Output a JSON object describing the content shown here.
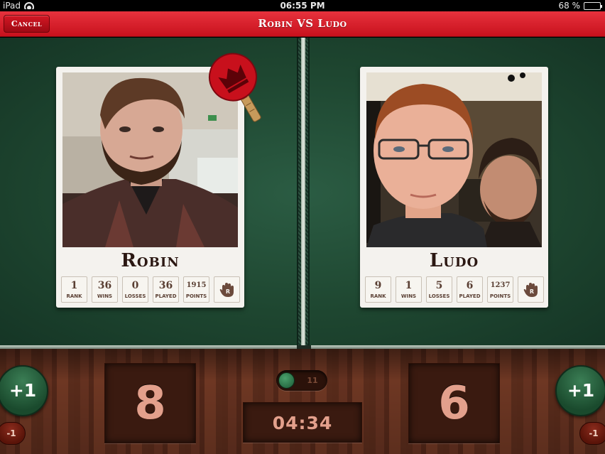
{
  "status_bar": {
    "device": "iPad",
    "time": "06:55 PM",
    "battery": "68 %",
    "battery_level": 0.68
  },
  "nav": {
    "title": "Robin VS Ludo",
    "cancel_label": "Cancel"
  },
  "players": {
    "left": {
      "name": "Robin",
      "stats": [
        {
          "value": "1",
          "label": "RANK"
        },
        {
          "value": "36",
          "label": "WINS"
        },
        {
          "value": "0",
          "label": "LOSSES"
        },
        {
          "value": "36",
          "label": "PLAYED"
        },
        {
          "value": "1915",
          "label": "POINTS"
        }
      ],
      "score": "8"
    },
    "right": {
      "name": "Ludo",
      "stats": [
        {
          "value": "9",
          "label": "RANK"
        },
        {
          "value": "1",
          "label": "WINS"
        },
        {
          "value": "5",
          "label": "LOSSES"
        },
        {
          "value": "6",
          "label": "PLAYED"
        },
        {
          "value": "1237",
          "label": "POINTS"
        }
      ],
      "score": "6"
    }
  },
  "controls": {
    "plus_label": "+1",
    "minus_label": "-1",
    "game_points": "11",
    "timer": "04:34"
  },
  "icons": [
    "wifi-icon",
    "battery-icon",
    "crown-paddle-icon",
    "hand-icon"
  ],
  "colors": {
    "nav_red": "#d11722",
    "table_green": "#1e4630",
    "score_text": "#e3a08c"
  }
}
